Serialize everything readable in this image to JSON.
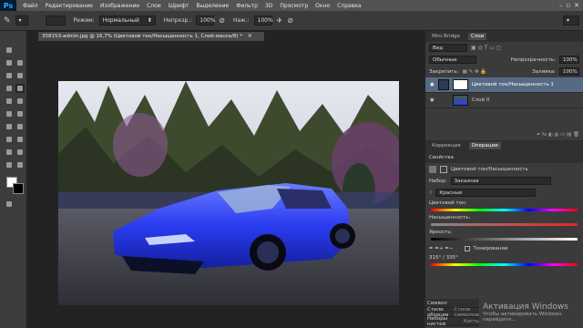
{
  "app": {
    "logo": "Ps"
  },
  "menu": [
    "Файл",
    "Редактирование",
    "Изображение",
    "Слои",
    "Шрифт",
    "Выделение",
    "Фильтр",
    "3D",
    "Просмотр",
    "Окно",
    "Справка"
  ],
  "options": {
    "mode_label": "Режим:",
    "mode_value": "Нормальный",
    "opacity_label": "Непрозр.:",
    "opacity_value": "100%",
    "press_label": "Наж.:",
    "press_value": "100%"
  },
  "document": {
    "tab_title": "358153-admin.jpg @ 16,7% (Цветовой тон/Насыщенность 1, Слой-маска/8) *"
  },
  "layers_panel": {
    "tabs": [
      "Mini Bridge",
      "Слои"
    ],
    "kind_label": "Вид",
    "blend_value": "Обычные",
    "opacity_label": "Непрозрачность:",
    "opacity_value": "100%",
    "lock_label": "Закрепить:",
    "fill_label": "Заливка:",
    "fill_value": "100%",
    "layers": [
      {
        "name": "Цветовой тон/Насыщенность 1",
        "selected": true
      },
      {
        "name": "Слой 0",
        "selected": false
      }
    ]
  },
  "properties": {
    "tabs": [
      "Коррекция",
      "Операции"
    ],
    "header": "Свойства",
    "adjustment_title": "Цветовой тон/Насыщенность",
    "preset_label": "Набор:",
    "preset_value": "Заказная",
    "channel_value": "Красные",
    "hue_label": "Цветовой тон:",
    "saturation_label": "Насыщенность:",
    "lightness_label": "Яркость:",
    "colorize_label": "Тонирование",
    "range_readout": "315° / 335°"
  },
  "bottom_tabs": [
    "Символ",
    "Стили абзацев",
    "Наборы кистей"
  ],
  "bottom_tabs_extra": [
    "Стили символов",
    "Кисть"
  ],
  "watermark": {
    "title": "Активация Windows",
    "subtitle": "Чтобы активировать Windows, перейдите..."
  },
  "colors": {
    "car": "#2a3cf0",
    "selected_layer": "#566a85",
    "accent": "#31a8ff"
  }
}
